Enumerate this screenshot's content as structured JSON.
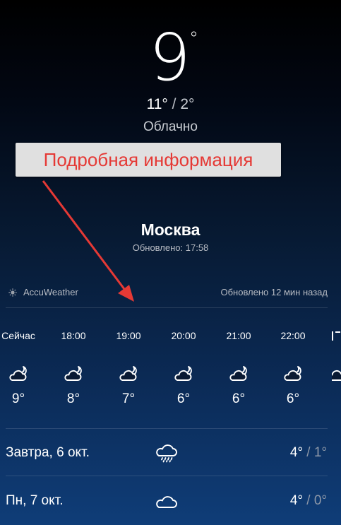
{
  "current": {
    "temperature": "9",
    "degree_sign": "°",
    "high": "11°",
    "separator": " / ",
    "low": "2°",
    "condition": "Облачно"
  },
  "callout": {
    "text": "Подробная информация",
    "color": "#e53935"
  },
  "location": {
    "city": "Москва",
    "updated": "Обновлено: 17:58"
  },
  "provider": {
    "name": "AccuWeather",
    "updated": "Обновлено 12 мин назад",
    "icon": "sun-icon"
  },
  "hourly": [
    {
      "time": "Сейчас",
      "temp": "9°",
      "icon": "partly-cloudy-night-icon"
    },
    {
      "time": "18:00",
      "temp": "8°",
      "icon": "partly-cloudy-night-icon"
    },
    {
      "time": "19:00",
      "temp": "7°",
      "icon": "partly-cloudy-night-icon"
    },
    {
      "time": "20:00",
      "temp": "6°",
      "icon": "partly-cloudy-night-icon"
    },
    {
      "time": "21:00",
      "temp": "6°",
      "icon": "partly-cloudy-night-icon"
    },
    {
      "time": "22:00",
      "temp": "6°",
      "icon": "partly-cloudy-night-icon"
    }
  ],
  "daily": [
    {
      "label": "Завтра, 6 окт.",
      "high": "4°",
      "separator": " / ",
      "low": "1°",
      "icon": "rain-cloud-icon"
    },
    {
      "label": "Пн, 7 окт.",
      "high": "4°",
      "separator": " / ",
      "low": "0°",
      "icon": "cloud-icon"
    }
  ]
}
